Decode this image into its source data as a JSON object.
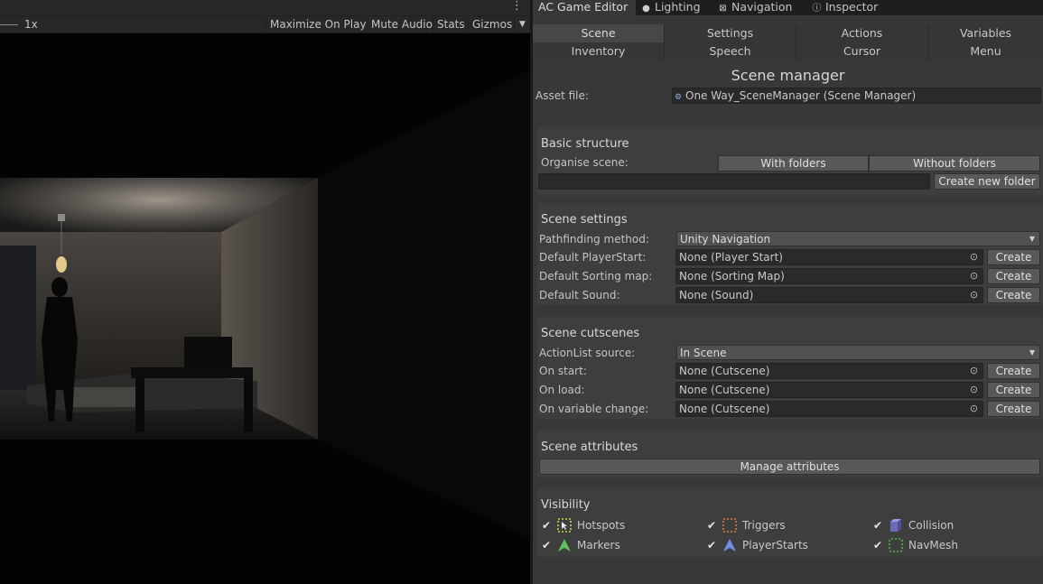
{
  "toolbar": {
    "scale": "1x",
    "maximize_label": "Maximize On Play",
    "mute_label": "Mute Audio",
    "stats_label": "Stats",
    "gizmos_label": "Gizmos"
  },
  "tabs": [
    {
      "label": "AC Game Editor",
      "icon": ""
    },
    {
      "label": "Lighting",
      "icon": "lightbulb-icon"
    },
    {
      "label": "Navigation",
      "icon": "navigation-icon"
    },
    {
      "label": "Inspector",
      "icon": "info-icon"
    }
  ],
  "nav": {
    "row1": [
      "Scene",
      "Settings",
      "Actions",
      "Variables"
    ],
    "row2": [
      "Inventory",
      "Speech",
      "Cursor",
      "Menu"
    ],
    "selected": "Scene"
  },
  "manager": {
    "title": "Scene manager",
    "asset_label": "Asset file:",
    "asset_value": "One Way_SceneManager (Scene Manager)"
  },
  "basic": {
    "header": "Basic structure",
    "organise_label": "Organise scene:",
    "with_folders": "With folders",
    "without_folders": "Without folders",
    "new_folder_value": "",
    "create_folder_label": "Create new folder"
  },
  "settings": {
    "header": "Scene settings",
    "pathfinding_label": "Pathfinding method:",
    "pathfinding_value": "Unity Navigation",
    "rows": [
      {
        "label": "Default PlayerStart:",
        "value": "None (Player Start)",
        "button": "Create"
      },
      {
        "label": "Default Sorting map:",
        "value": "None (Sorting Map)",
        "button": "Create"
      },
      {
        "label": "Default Sound:",
        "value": "None (Sound)",
        "button": "Create"
      }
    ]
  },
  "cutscenes": {
    "header": "Scene cutscenes",
    "source_label": "ActionList source:",
    "source_value": "In Scene",
    "rows": [
      {
        "label": "On start:",
        "value": "None (Cutscene)",
        "button": "Create"
      },
      {
        "label": "On load:",
        "value": "None (Cutscene)",
        "button": "Create"
      },
      {
        "label": "On variable change:",
        "value": "None (Cutscene)",
        "button": "Create"
      }
    ]
  },
  "attributes": {
    "header": "Scene attributes",
    "manage_label": "Manage attributes"
  },
  "visibility": {
    "header": "Visibility",
    "items": [
      {
        "label": "Hotspots",
        "checked": true,
        "icon": "hotspot-icon",
        "color": "#d8d23a"
      },
      {
        "label": "Triggers",
        "checked": true,
        "icon": "trigger-icon",
        "color": "#e0783a"
      },
      {
        "label": "Collision",
        "checked": true,
        "icon": "collision-icon",
        "color": "#8a8ad8"
      },
      {
        "label": "Markers",
        "checked": true,
        "icon": "marker-icon",
        "color": "#5fc25f"
      },
      {
        "label": "PlayerStarts",
        "checked": true,
        "icon": "playerstart-icon",
        "color": "#6e8ee8"
      },
      {
        "label": "NavMesh",
        "checked": true,
        "icon": "navmesh-icon",
        "color": "#4fb84f"
      }
    ]
  },
  "colors": {
    "panel_bg": "#383838",
    "section_bg": "#3e3e3e",
    "field_bg": "#2a2a2a",
    "button_bg": "#585858"
  }
}
